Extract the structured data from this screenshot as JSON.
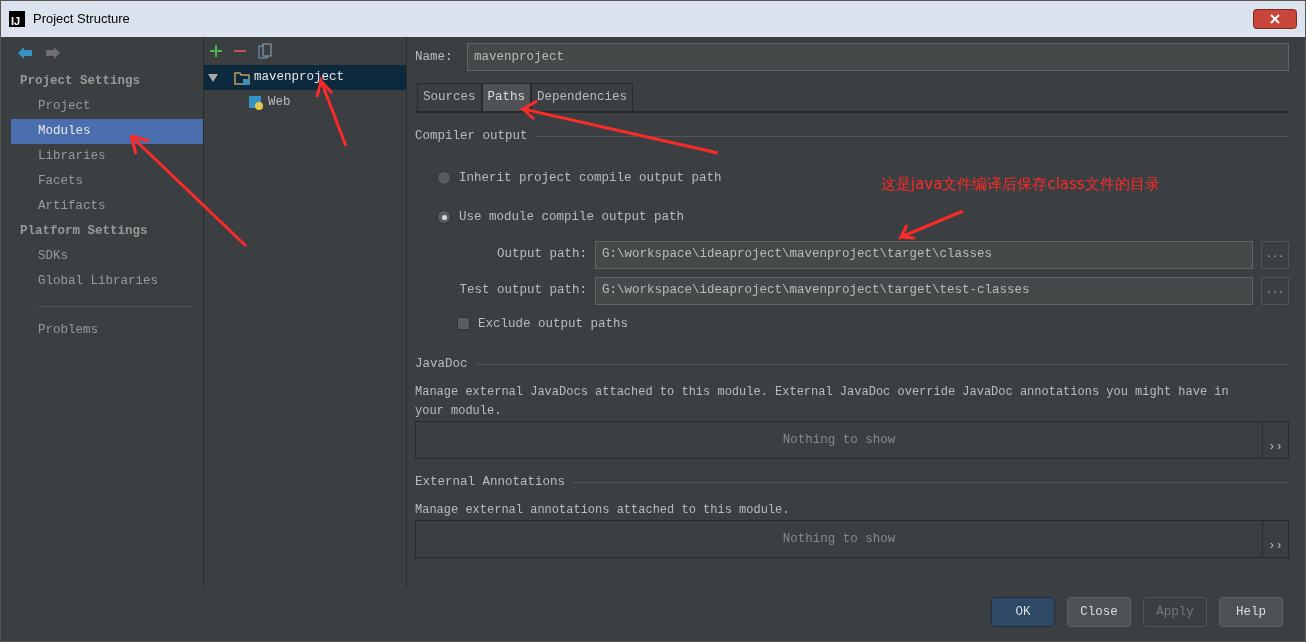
{
  "window": {
    "title": "Project Structure",
    "logo": "IJ"
  },
  "sidebar": {
    "items": [
      {
        "kind": "header",
        "label": "Project Settings"
      },
      {
        "kind": "item",
        "label": "Project",
        "selected": false
      },
      {
        "kind": "item",
        "label": "Modules",
        "selected": true
      },
      {
        "kind": "item",
        "label": "Libraries",
        "selected": false
      },
      {
        "kind": "item",
        "label": "Facets",
        "selected": false
      },
      {
        "kind": "item",
        "label": "Artifacts",
        "selected": false
      },
      {
        "kind": "header",
        "label": "Platform Settings"
      },
      {
        "kind": "item",
        "label": "SDKs",
        "selected": false
      },
      {
        "kind": "item",
        "label": "Global Libraries",
        "selected": false
      },
      {
        "kind": "separator"
      },
      {
        "kind": "item",
        "label": "Problems",
        "selected": false
      }
    ]
  },
  "tree": {
    "items": [
      {
        "label": "mavenproject",
        "kind": "module",
        "expanded": true,
        "selected": true,
        "children": [
          {
            "label": "Web",
            "kind": "web",
            "selected": false
          }
        ]
      }
    ]
  },
  "name_field": {
    "label": "Name:",
    "value": "mavenproject"
  },
  "tabs": [
    {
      "label": "Sources",
      "selected": false
    },
    {
      "label": "Paths",
      "selected": true
    },
    {
      "label": "Dependencies",
      "selected": false
    }
  ],
  "compiler_output": {
    "title": "Compiler output",
    "options": [
      {
        "label": "Inherit project compile output path",
        "selected": false
      },
      {
        "label": "Use module compile output path",
        "selected": true
      }
    ],
    "paths": [
      {
        "label": "Output path:",
        "value": "G:\\workspace\\ideaproject\\mavenproject\\target\\classes",
        "button": "..."
      },
      {
        "label": "Test output path:",
        "value": "G:\\workspace\\ideaproject\\mavenproject\\target\\test-classes",
        "button": "..."
      }
    ],
    "exclude": {
      "label": "Exclude output paths",
      "checked": false
    }
  },
  "sections": [
    {
      "title": "JavaDoc",
      "description": "Manage external JavaDocs attached to this module. External JavaDoc override JavaDoc annotations you might have in your module.",
      "empty_text": "Nothing to show",
      "more": "››"
    },
    {
      "title": "External Annotations",
      "description": "Manage external annotations attached to this module.",
      "empty_text": "Nothing to show",
      "more": "››"
    }
  ],
  "annotation": "这是java文件编译后保存class文件的目录",
  "buttons": [
    {
      "label": "OK",
      "kind": "default",
      "disabled": false
    },
    {
      "label": "Close",
      "kind": "normal",
      "disabled": false
    },
    {
      "label": "Apply",
      "kind": "normal",
      "disabled": true
    },
    {
      "label": "Help",
      "kind": "normal",
      "disabled": false
    }
  ]
}
